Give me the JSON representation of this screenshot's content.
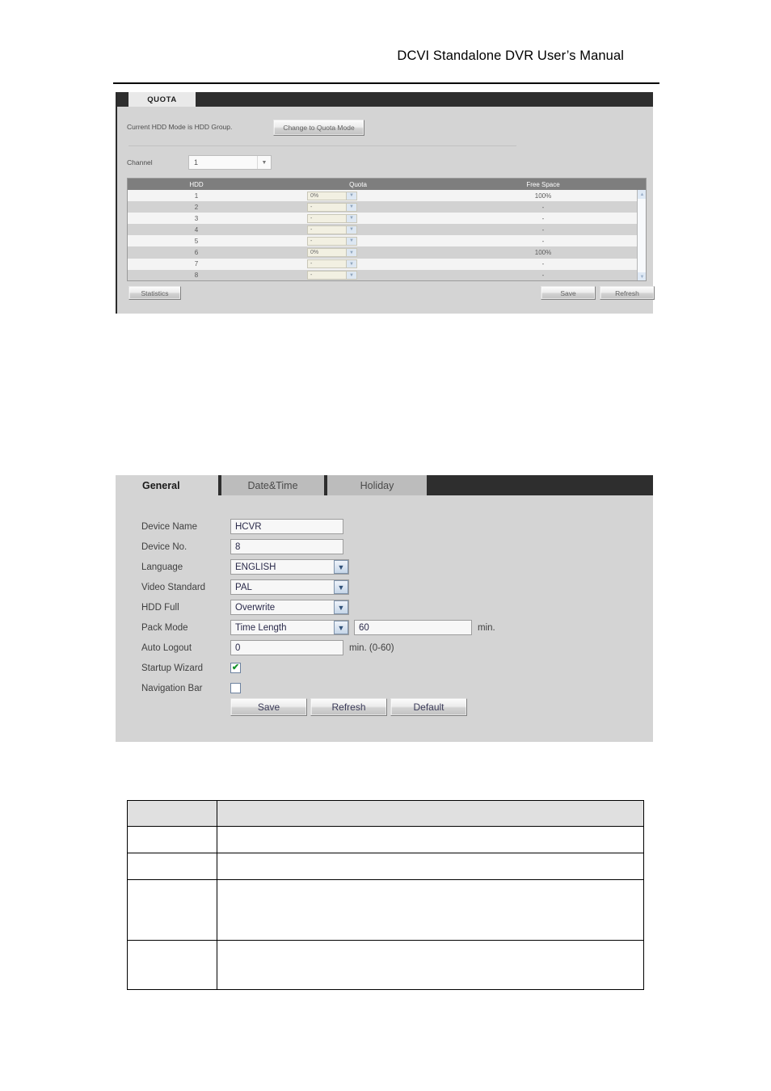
{
  "page": {
    "header_title": "DCVI Standalone DVR User’s Manual"
  },
  "quota_panel": {
    "tab_label": "QUOTA",
    "hdd_mode_text": "Current HDD Mode is HDD Group.",
    "change_mode_button": "Change to Quota Mode",
    "channel_label": "Channel",
    "channel_value": "1",
    "table": {
      "columns": [
        "HDD",
        "Quota",
        "Free Space"
      ],
      "rows": [
        {
          "hdd": "1",
          "quota": "0%",
          "free_space": "100%"
        },
        {
          "hdd": "2",
          "quota": "-",
          "free_space": "-"
        },
        {
          "hdd": "3",
          "quota": "-",
          "free_space": "-"
        },
        {
          "hdd": "4",
          "quota": "-",
          "free_space": "-"
        },
        {
          "hdd": "5",
          "quota": "-",
          "free_space": "-"
        },
        {
          "hdd": "6",
          "quota": "0%",
          "free_space": "100%"
        },
        {
          "hdd": "7",
          "quota": "-",
          "free_space": "-"
        },
        {
          "hdd": "8",
          "quota": "-",
          "free_space": "-"
        }
      ]
    },
    "statistics_button": "Statistics",
    "save_button": "Save",
    "refresh_button": "Refresh",
    "scroll_up_icon": "scroll-up-arrow-icon",
    "scroll_down_icon": "scroll-down-arrow-icon"
  },
  "general_panel": {
    "tabs": [
      {
        "label": "General",
        "active": true
      },
      {
        "label": "Date&Time",
        "active": false
      },
      {
        "label": "Holiday",
        "active": false
      }
    ],
    "fields": {
      "device_name_label": "Device Name",
      "device_name_value": "HCVR",
      "device_no_label": "Device No.",
      "device_no_value": "8",
      "language_label": "Language",
      "language_value": "ENGLISH",
      "video_standard_label": "Video Standard",
      "video_standard_value": "PAL",
      "hdd_full_label": "HDD Full",
      "hdd_full_value": "Overwrite",
      "pack_mode_label": "Pack Mode",
      "pack_mode_value": "Time Length",
      "pack_mode_number": "60",
      "pack_mode_unit": "min.",
      "auto_logout_label": "Auto Logout",
      "auto_logout_value": "0",
      "auto_logout_unit": "min. (0-60)",
      "startup_wizard_label": "Startup Wizard",
      "startup_wizard_checked": "✔",
      "navigation_bar_label": "Navigation Bar",
      "navigation_bar_checked": ""
    },
    "buttons": {
      "save": "Save",
      "refresh": "Refresh",
      "default": "Default"
    },
    "dropdown_icon": "chevron-down-icon"
  },
  "bottom_table": {
    "header": [
      "",
      ""
    ],
    "rows": [
      [
        "",
        ""
      ],
      [
        "",
        ""
      ],
      [
        "",
        ""
      ],
      [
        "",
        ""
      ]
    ]
  }
}
